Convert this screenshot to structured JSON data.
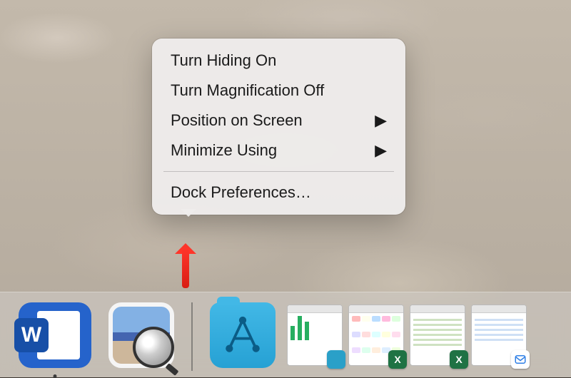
{
  "menu": {
    "items": [
      {
        "label": "Turn Hiding On",
        "has_submenu": false
      },
      {
        "label": "Turn Magnification Off",
        "has_submenu": false
      },
      {
        "label": "Position on Screen",
        "has_submenu": true
      },
      {
        "label": "Minimize Using",
        "has_submenu": true
      }
    ],
    "after_separator": {
      "label": "Dock Preferences…",
      "has_submenu": false
    }
  },
  "dock": {
    "apps": [
      {
        "name": "Microsoft Word",
        "running": true,
        "kind": "word"
      },
      {
        "name": "Preview",
        "running": false,
        "kind": "preview"
      }
    ],
    "folder": {
      "name": "Applications"
    },
    "minimized": [
      {
        "app": "Snagit",
        "badge_color": "#2aa0c8",
        "content": "bars"
      },
      {
        "app": "Excel",
        "badge_color": "#1f7244",
        "content": "cells"
      },
      {
        "app": "Excel",
        "badge_color": "#1f7244",
        "content": "lines"
      },
      {
        "app": "Mail",
        "badge_color": "#2f7fe6",
        "content": "lines"
      }
    ]
  },
  "glyphs": {
    "submenu_arrow": "▶"
  }
}
